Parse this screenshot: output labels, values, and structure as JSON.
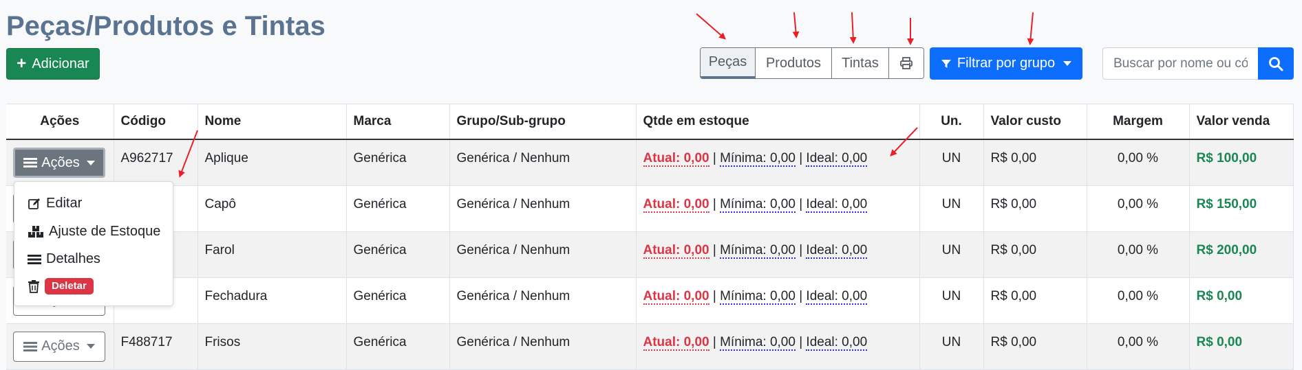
{
  "header": {
    "title": "Peças/Produtos e Tintas",
    "add_label": "Adicionar"
  },
  "toolbar": {
    "segments": [
      {
        "label": "Peças",
        "active": true
      },
      {
        "label": "Produtos",
        "active": false
      },
      {
        "label": "Tintas",
        "active": false
      }
    ],
    "print_icon": "printer-icon",
    "filter_label": "Filtrar por grupo",
    "search_placeholder": "Buscar por nome ou código"
  },
  "table": {
    "columns": [
      "Ações",
      "Código",
      "Nome",
      "Marca",
      "Grupo/Sub-grupo",
      "Qtde em estoque",
      "Un.",
      "Valor custo",
      "Margem",
      "Valor venda"
    ],
    "action_label": "Ações",
    "rows": [
      {
        "codigo": "A962717",
        "nome": "Aplique",
        "marca": "Genérica",
        "grupo": "Genérica / Nenhum",
        "atual": "Atual: 0,00",
        "minima": "Mínima: 0,00",
        "ideal": "Ideal: 0,00",
        "un": "UN",
        "custo": "R$ 0,00",
        "margem": "0,00 %",
        "venda": "R$ 100,00"
      },
      {
        "codigo": "",
        "nome": "Capô",
        "marca": "Genérica",
        "grupo": "Genérica / Nenhum",
        "atual": "Atual: 0,00",
        "minima": "Mínima: 0,00",
        "ideal": "Ideal: 0,00",
        "un": "UN",
        "custo": "R$ 0,00",
        "margem": "0,00 %",
        "venda": "R$ 150,00"
      },
      {
        "codigo": "",
        "nome": "Farol",
        "marca": "Genérica",
        "grupo": "Genérica / Nenhum",
        "atual": "Atual: 0,00",
        "minima": "Mínima: 0,00",
        "ideal": "Ideal: 0,00",
        "un": "UN",
        "custo": "R$ 0,00",
        "margem": "0,00 %",
        "venda": "R$ 200,00"
      },
      {
        "codigo": "",
        "nome": "Fechadura",
        "marca": "Genérica",
        "grupo": "Genérica / Nenhum",
        "atual": "Atual: 0,00",
        "minima": "Mínima: 0,00",
        "ideal": "Ideal: 0,00",
        "un": "UN",
        "custo": "R$ 0,00",
        "margem": "0,00 %",
        "venda": "R$ 0,00"
      },
      {
        "codigo": "F488717",
        "nome": "Frisos",
        "marca": "Genérica",
        "grupo": "Genérica / Nenhum",
        "atual": "Atual: 0,00",
        "minima": "Mínima: 0,00",
        "ideal": "Ideal: 0,00",
        "un": "UN",
        "custo": "R$ 0,00",
        "margem": "0,00 %",
        "venda": "R$ 0,00"
      }
    ]
  },
  "dropdown": {
    "editar": "Editar",
    "ajuste": "Ajuste de Estoque",
    "detalhes": "Detalhes",
    "deletar": "Deletar"
  },
  "colors": {
    "title": "#5a7391",
    "success": "#198754",
    "primary": "#0d6efd",
    "danger": "#dc3545",
    "annotation_arrow": "#e8202a"
  }
}
